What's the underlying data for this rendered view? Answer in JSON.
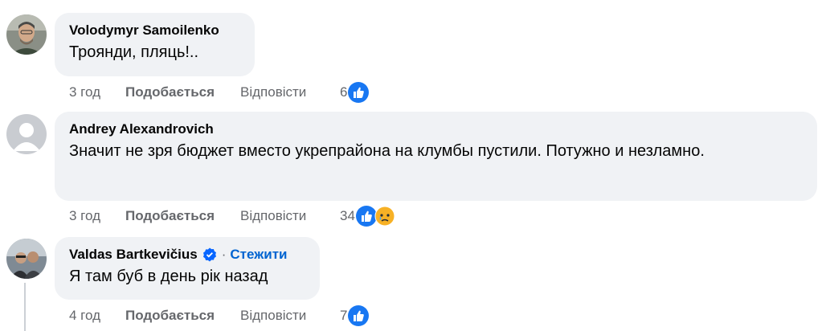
{
  "comments": [
    {
      "author": "Volodymyr Samoilenko",
      "text": "Троянди, пляць!..",
      "time": "3 год",
      "like_label": "Подобається",
      "reply_label": "Відповісти",
      "reaction_count": "6",
      "reactions": [
        "like-icon"
      ]
    },
    {
      "author": "Andrey Alexandrovich",
      "text": "Значит не зря бюджет вместо укрепрайона на клумбы пустили. Потужно и незламно.",
      "time": "3 год",
      "like_label": "Подобається",
      "reply_label": "Відповісти",
      "reaction_count": "34",
      "reactions": [
        "like-icon",
        "sad-icon"
      ]
    },
    {
      "author": "Valdas Bartkevičius",
      "verified": true,
      "separator": "·",
      "follow_label": "Стежити",
      "text": "Я там буб в день рік назад",
      "time": "4 год",
      "like_label": "Подобається",
      "reply_label": "Відповісти",
      "reaction_count": "7",
      "reactions": [
        "like-icon"
      ]
    }
  ],
  "colors": {
    "bubble": "#f0f2f5",
    "like_blue": "#1877f2",
    "link_blue": "#0064d1",
    "meta_gray": "#65676b"
  }
}
